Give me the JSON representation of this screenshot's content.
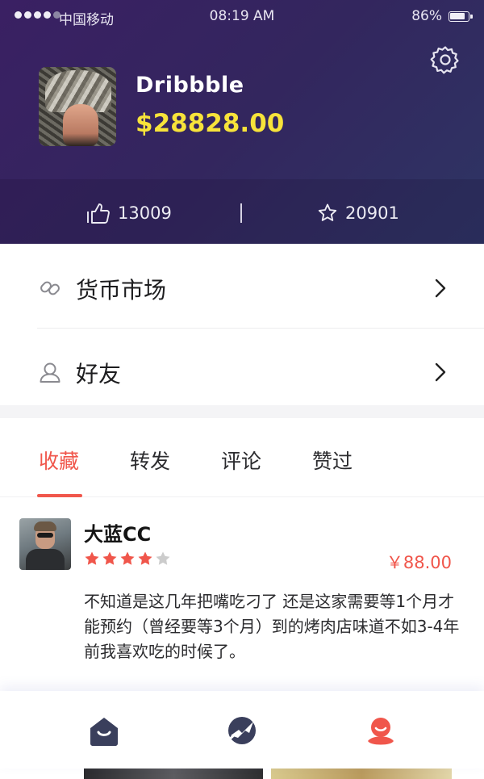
{
  "status_bar": {
    "carrier": "中国移动",
    "time": "08:19 AM",
    "battery": "86%"
  },
  "profile": {
    "name": "Dribbble",
    "balance": "$28828.00"
  },
  "stats": {
    "likes": "13009",
    "favorites": "20901"
  },
  "menu": {
    "items": [
      {
        "label": "货币市场",
        "icon": "currency-market-icon"
      },
      {
        "label": "好友",
        "icon": "friend-icon"
      }
    ]
  },
  "tabs": [
    {
      "label": "收藏",
      "active": true
    },
    {
      "label": "转发",
      "active": false
    },
    {
      "label": "评论",
      "active": false
    },
    {
      "label": "赞过",
      "active": false
    }
  ],
  "post": {
    "user": "大蓝CC",
    "rating": 4,
    "rating_max": 5,
    "price": "￥88.00",
    "text": "不知道是这几年把嘴吃刁了 还是这家需要等1个月才能预约（曾经要等3个月）到的烤肉店味道不如3-4年前我喜欢吃的时候了。"
  },
  "tabbar": {
    "items": [
      {
        "icon": "home-icon",
        "active": false
      },
      {
        "icon": "explore-icon",
        "active": false
      },
      {
        "icon": "profile-icon",
        "active": true
      }
    ]
  },
  "colors": {
    "accent": "#f0564b",
    "balance": "#f7e33a",
    "header_start": "#3a2063",
    "header_end": "#2e3564",
    "star_on": "#f0564b",
    "star_off": "#cccccc",
    "tab_icon": "#3a3f5c"
  }
}
